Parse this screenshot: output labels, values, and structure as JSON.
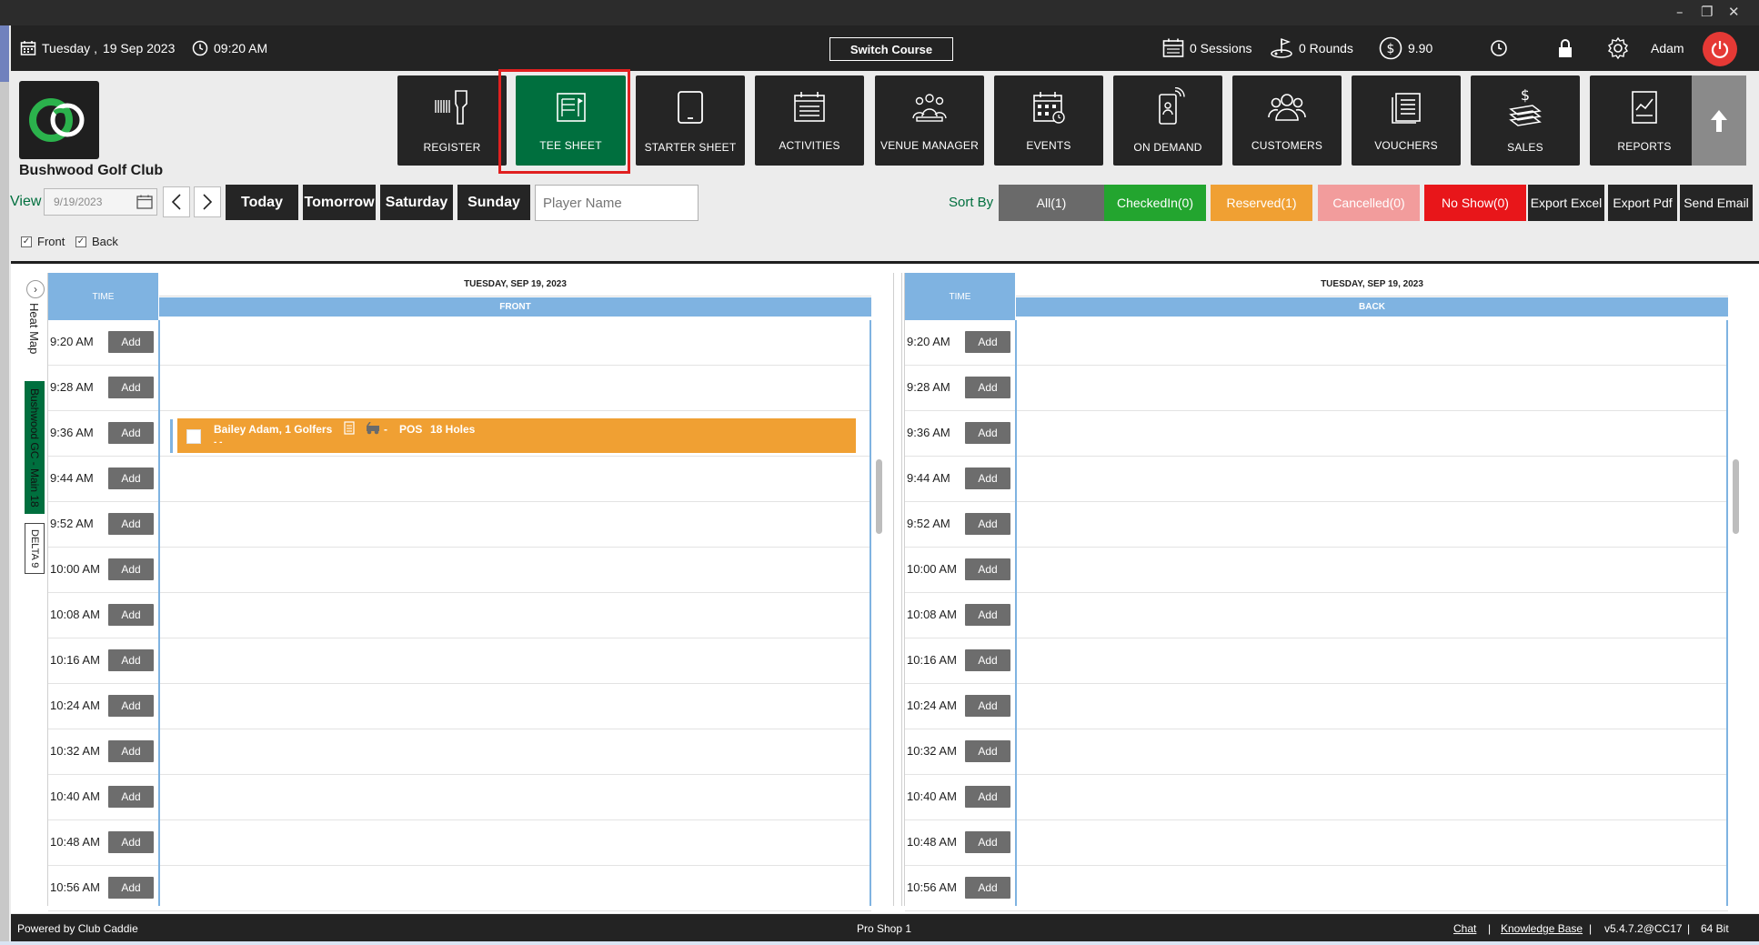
{
  "header": {
    "day": "Tuesday ,",
    "date": "19 Sep 2023",
    "time": "09:20 AM",
    "switch_course": "Switch Course",
    "sessions": "0 Sessions",
    "rounds": "0 Rounds",
    "balance": "9.90",
    "user": "Adam"
  },
  "club": {
    "name": "Bushwood Golf Club"
  },
  "nav": [
    {
      "label": "REGISTER",
      "icon": "barcode-scanner-icon"
    },
    {
      "label": "TEE SHEET",
      "icon": "tee-sheet-icon",
      "active": true
    },
    {
      "label": "STARTER SHEET",
      "icon": "tablet-icon"
    },
    {
      "label": "ACTIVITIES",
      "icon": "activities-icon"
    },
    {
      "label": "VENUE MANAGER",
      "icon": "venue-icon"
    },
    {
      "label": "EVENTS",
      "icon": "events-icon"
    },
    {
      "label": "ON DEMAND",
      "icon": "on-demand-icon"
    },
    {
      "label": "CUSTOMERS",
      "icon": "customers-icon"
    },
    {
      "label": "VOUCHERS",
      "icon": "vouchers-icon"
    },
    {
      "label": "SALES",
      "icon": "sales-icon"
    },
    {
      "label": "REPORTS",
      "icon": "reports-icon"
    }
  ],
  "toolbar": {
    "view_label": "View",
    "date_value": "9/19/2023",
    "days": [
      "Today",
      "Tomorrow",
      "Saturday",
      "Sunday"
    ],
    "player_placeholder": "Player Name",
    "sort_by": "Sort By",
    "filters": [
      {
        "label": "All(1)",
        "color": "#6a6a6a"
      },
      {
        "label": "CheckedIn(0)",
        "color": "#23a52f"
      },
      {
        "label": "Reserved(1)",
        "color": "#f0a033"
      },
      {
        "label": "Cancelled(0)",
        "color": "#f29c9c"
      },
      {
        "label": "No Show(0)",
        "color": "#e8161a"
      }
    ],
    "actions": [
      "Export Excel",
      "Export Pdf",
      "Send Email"
    ],
    "front_label": "Front",
    "back_label": "Back"
  },
  "sidebar": {
    "heat_map": "Heat Map",
    "course": "Bushwood GC - Main 18",
    "delta": "DELTA 9"
  },
  "grid": {
    "time_header": "TIME",
    "date_header": "TUESDAY, SEP 19, 2023",
    "front_header": "FRONT",
    "back_header": "BACK",
    "add_label": "Add",
    "times": [
      "9:20 AM",
      "9:28 AM",
      "9:36 AM",
      "9:44 AM",
      "9:52 AM",
      "10:00 AM",
      "10:08 AM",
      "10:16 AM",
      "10:24 AM",
      "10:32 AM",
      "10:40 AM",
      "10:48 AM",
      "10:56 AM"
    ]
  },
  "booking": {
    "player": "Bailey Adam, 1 Golfers",
    "cart_dash": "-",
    "source": "POS",
    "holes": "18 Holes",
    "sub": "-  -",
    "color": "#f0a033"
  },
  "status": {
    "powered": "Powered by Club Caddie",
    "station": "Pro Shop 1",
    "chat": "Chat",
    "kb": "Knowledge Base",
    "version": "v5.4.7.2@CC17",
    "arch": "64 Bit"
  }
}
